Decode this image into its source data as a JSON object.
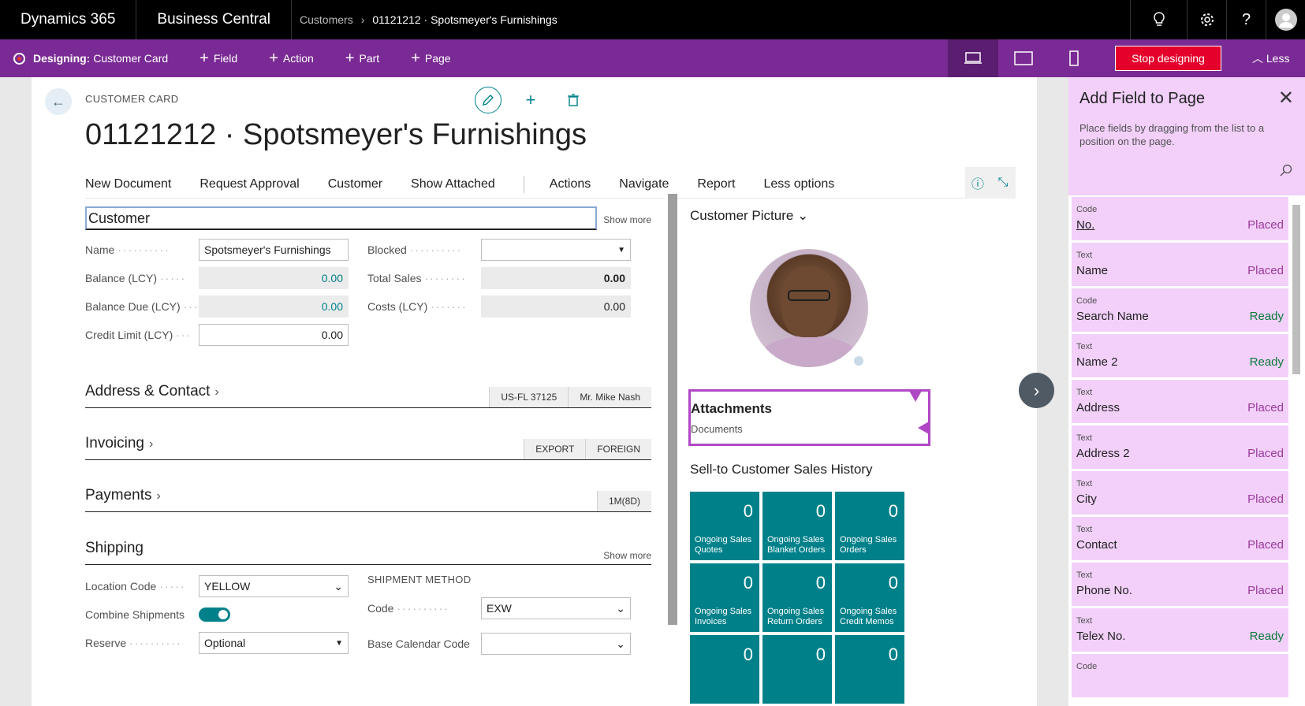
{
  "topbar": {
    "app1": "Dynamics 365",
    "app2": "Business Central",
    "breadcrumb": [
      "Customers",
      "01121212 · Spotsmeyer's Furnishings"
    ],
    "icons": [
      "lightbulb-icon",
      "gear-icon",
      "help-icon",
      "avatar-icon"
    ]
  },
  "designbar": {
    "prefix": "Designing:",
    "page": "Customer Card",
    "actions": [
      "Field",
      "Action",
      "Part",
      "Page"
    ],
    "stop_label": "Stop designing",
    "less_label": "Less",
    "accent": "#7a2a94"
  },
  "card": {
    "type": "CUSTOMER CARD",
    "title": "01121212 · Spotsmeyer's Furnishings",
    "actions": [
      "New Document",
      "Request Approval",
      "Customer",
      "Show Attached",
      "Actions",
      "Navigate",
      "Report",
      "Less options"
    ]
  },
  "customer": {
    "header": "Customer",
    "show_more": "Show more",
    "fields": {
      "name_label": "Name",
      "name_value": "Spotsmeyer's Furnishings",
      "balance_label": "Balance (LCY)",
      "balance_value": "0.00",
      "balance_due_label": "Balance Due (LCY)",
      "balance_due_value": "0.00",
      "credit_limit_label": "Credit Limit (LCY)",
      "credit_limit_value": "0.00",
      "blocked_label": "Blocked",
      "blocked_value": "",
      "total_sales_label": "Total Sales",
      "total_sales_value": "0.00",
      "costs_label": "Costs (LCY)",
      "costs_value": "0.00"
    }
  },
  "sections": {
    "address": {
      "title": "Address & Contact",
      "pills": [
        "US-FL 37125",
        "Mr. Mike Nash"
      ]
    },
    "invoicing": {
      "title": "Invoicing",
      "pills": [
        "EXPORT",
        "FOREIGN"
      ]
    },
    "payments": {
      "title": "Payments",
      "pills": [
        "1M(8D)"
      ]
    },
    "shipping": {
      "title": "Shipping",
      "show_more": "Show more",
      "location_label": "Location Code",
      "location_value": "YELLOW",
      "combine_label": "Combine Shipments",
      "reserve_label": "Reserve",
      "reserve_value": "Optional",
      "method_header": "SHIPMENT METHOD",
      "code_label": "Code",
      "code_value": "EXW",
      "calendar_label": "Base Calendar Code",
      "calendar_value": ""
    }
  },
  "factbox": {
    "picture_title": "Customer Picture",
    "attachments_title": "Attachments",
    "attachments_sub": "Documents",
    "history_title": "Sell-to Customer Sales History",
    "tiles": [
      {
        "value": "0",
        "label": "Ongoing Sales Quotes"
      },
      {
        "value": "0",
        "label": "Ongoing Sales Blanket Orders"
      },
      {
        "value": "0",
        "label": "Ongoing Sales Orders"
      },
      {
        "value": "0",
        "label": "Ongoing Sales Invoices"
      },
      {
        "value": "0",
        "label": "Ongoing Sales Return Orders"
      },
      {
        "value": "0",
        "label": "Ongoing Sales Credit Memos"
      },
      {
        "value": "0",
        "label": ""
      },
      {
        "value": "0",
        "label": ""
      },
      {
        "value": "0",
        "label": ""
      }
    ]
  },
  "panel": {
    "title": "Add Field to Page",
    "desc": "Place fields by dragging from the list to a position on the page.",
    "items": [
      {
        "type": "Code",
        "name": "No.",
        "status": "Placed"
      },
      {
        "type": "Text",
        "name": "Name",
        "status": "Placed"
      },
      {
        "type": "Code",
        "name": "Search Name",
        "status": "Ready"
      },
      {
        "type": "Text",
        "name": "Name 2",
        "status": "Ready"
      },
      {
        "type": "Text",
        "name": "Address",
        "status": "Placed"
      },
      {
        "type": "Text",
        "name": "Address 2",
        "status": "Placed"
      },
      {
        "type": "Text",
        "name": "City",
        "status": "Placed"
      },
      {
        "type": "Text",
        "name": "Contact",
        "status": "Placed"
      },
      {
        "type": "Text",
        "name": "Phone No.",
        "status": "Placed"
      },
      {
        "type": "Text",
        "name": "Telex No.",
        "status": "Ready"
      },
      {
        "type": "Code",
        "name": "",
        "status": ""
      }
    ]
  }
}
